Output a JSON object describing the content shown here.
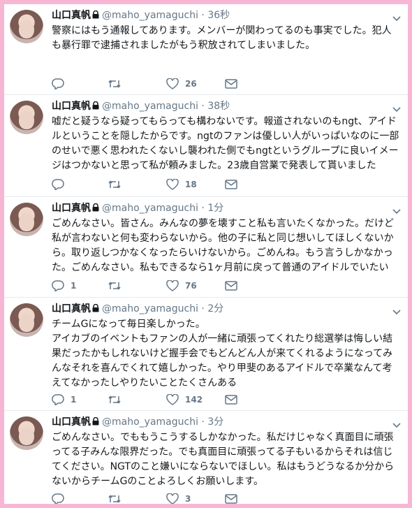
{
  "tweets": [
    {
      "name": "山口真帆",
      "handle": "@maho_yamaguchi",
      "time": "36秒",
      "body": "警察にはもう通報してあります。メンバーが関わってるのも事実でした。犯人も暴行罪で逮捕されましたがもう釈放されてしまいました。",
      "replies": "",
      "retweets": "",
      "likes": "26"
    },
    {
      "name": "山口真帆",
      "handle": "@maho_yamaguchi",
      "time": "38秒",
      "body": "嘘だと疑うなら疑ってもらっても構わないです。報道されないのもngt、アイドルということを隠したからです。ngtのファンは優しい人がいっぱいなのに一部のせいで悪く思われたくないし襲われた側でもngtというグループに良いイメージはつかないと思って私が頼みました。23歳自営業で発表して貰いました",
      "replies": "",
      "retweets": "",
      "likes": "18"
    },
    {
      "name": "山口真帆",
      "handle": "@maho_yamaguchi",
      "time": "1分",
      "body": "ごめんなさい。皆さん。みんなの夢を壊すこと私も言いたくなかった。だけど私が言わないと何も変わらないから。他の子に私と同じ想いしてほしくないから。取り返しつかなくなったらいけないから。ごめんね。もう言うしかなかった。ごめんなさい。私もできるなら1ヶ月前に戻って普通のアイドルでいたい",
      "replies": "1",
      "retweets": "",
      "likes": "76"
    },
    {
      "name": "山口真帆",
      "handle": "@maho_yamaguchi",
      "time": "2分",
      "body": "チームGになって毎日楽しかった。\nアイカブのイベントもファンの人が一緒に頑張ってくれたり総選挙は悔しい結果だったかもしれないけど握手会でもどんどん人が来てくれるようになってみんなそれを喜んでくれて嬉しかった。やり甲斐のあるアイドルで卒業なんて考えてなかったしやりたいことたくさんある",
      "replies": "1",
      "retweets": "",
      "likes": "142"
    },
    {
      "name": "山口真帆",
      "handle": "@maho_yamaguchi",
      "time": "3分",
      "body": "ごめんなさい。でももうこうするしかなかった。私だけじゃなく真面目に頑張ってる子みんな限界だった。でも真面目に頑張ってる子もいるからそれは信じてください。NGTのこと嫌いにならないでほしい。私はもうどうなるか分からないからチームGのことよろしくお願いします。",
      "replies": "",
      "retweets": "",
      "likes": "3"
    }
  ],
  "colors": {
    "frame": "#f7b6d4",
    "secondary_text": "#657786",
    "primary_text": "#14171a"
  },
  "icons": [
    "lock-icon",
    "chevron-down-icon",
    "reply-icon",
    "retweet-icon",
    "like-icon",
    "mail-icon"
  ]
}
